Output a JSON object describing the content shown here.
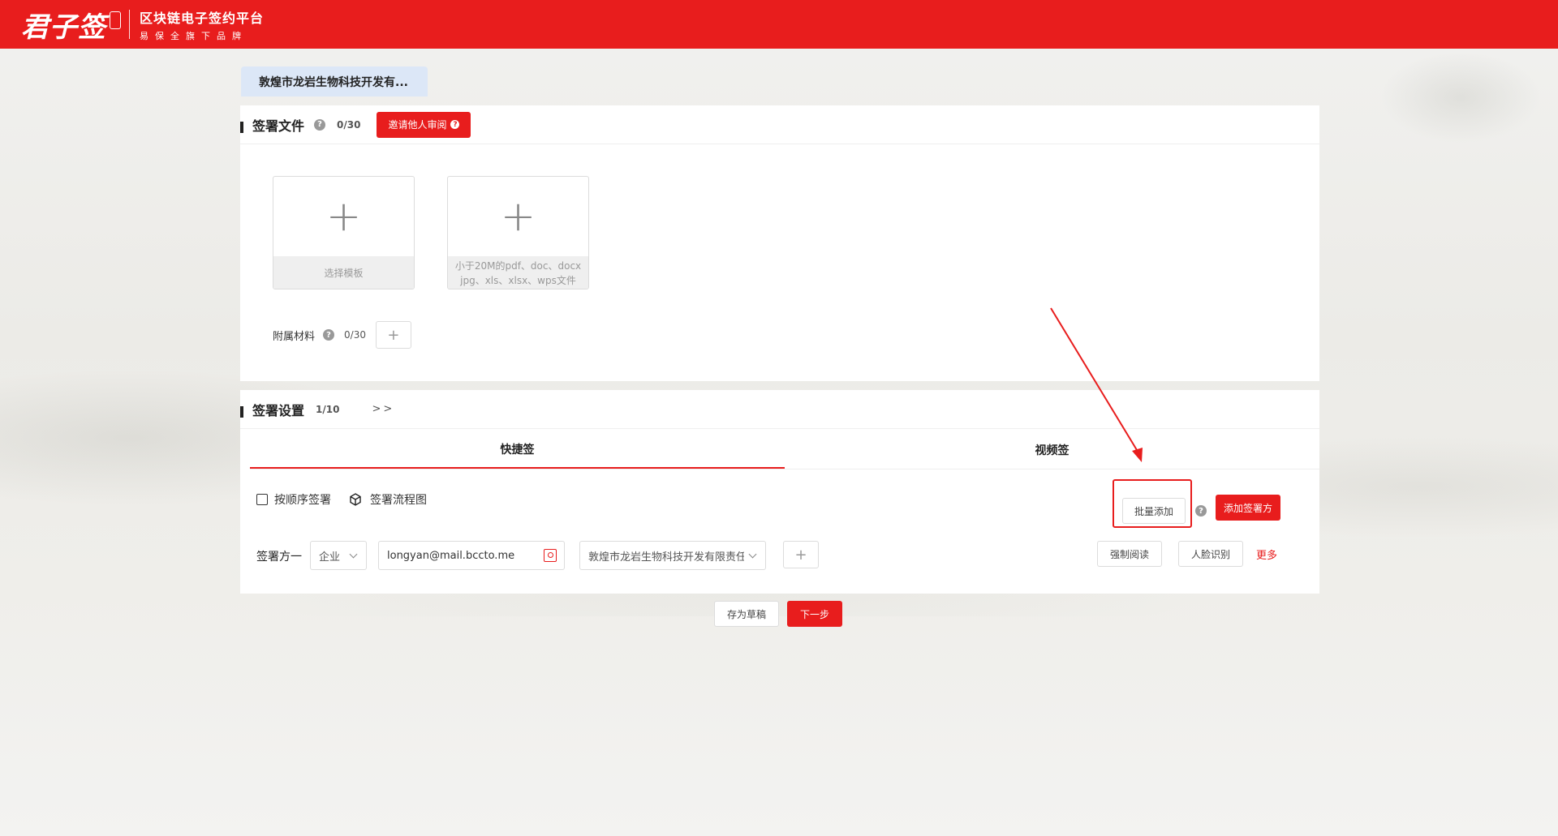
{
  "header": {
    "logo": "君子签",
    "platform_title": "区块链电子签约平台",
    "platform_sub": "易保全旗下品牌"
  },
  "company_tab": "敦煌市龙岩生物科技开发有...",
  "files": {
    "title": "签署文件",
    "count": "0/30",
    "invite_label": "邀请他人审阅",
    "template_caption": "选择模板",
    "upload_caption_1": "小于20M的pdf、doc、docx",
    "upload_caption_2": "jpg、xls、xlsx、wps文件",
    "attach_label": "附属材料",
    "attach_count": "0/30",
    "plus": "+"
  },
  "settings": {
    "title": "签署设置",
    "count": "1/10",
    "extra": ">>",
    "tabs": [
      {
        "label": "快捷签",
        "active": true
      },
      {
        "label": "视频签",
        "active": false
      }
    ],
    "ordered_label": "按顺序签署",
    "flow_label": "签署流程图",
    "batch_add": "批量添加",
    "add_signer": "添加签署方",
    "signer": {
      "label": "签署方一",
      "type": "企业",
      "email": "longyan@mail.bccto.me",
      "company": "敦煌市龙岩生物科技开发有限责任公司",
      "plus": "+",
      "force_read": "强制阅读",
      "face_id": "人脸识别",
      "more": "更多"
    }
  },
  "actions": {
    "save_draft": "存为草稿",
    "next": "下一步"
  },
  "colors": {
    "brand_red": "#e81d1d",
    "tab_blue": "#dce7f7"
  }
}
